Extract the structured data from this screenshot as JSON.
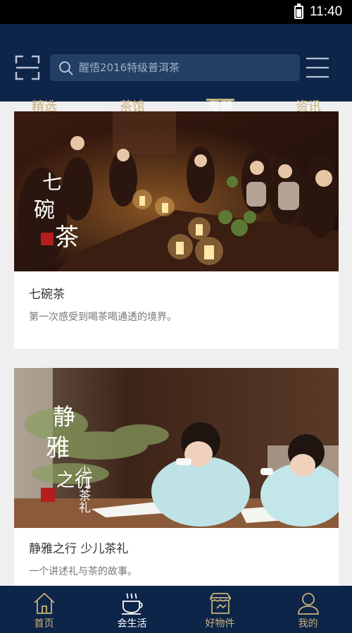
{
  "status_bar": {
    "time": "11:40"
  },
  "header": {
    "search_placeholder": "醒悟2016特级普洱茶"
  },
  "tabs": [
    {
      "label": "精选"
    },
    {
      "label": "茶馆"
    },
    {
      "label": "专题",
      "active": true
    },
    {
      "label": "资讯"
    }
  ],
  "cards": [
    {
      "title": "七碗茶",
      "description": "第一次感受到喝茶喝通透的境界。",
      "image_text": {
        "line1": "七",
        "line2": "碗",
        "line3": "茶"
      }
    },
    {
      "title": "静雅之行 少儿茶礼",
      "description": "一个讲述礼与茶的故事。",
      "image_text": {
        "main1": "静",
        "main2": "雅",
        "main3": "之行",
        "sub": "少儿茶礼"
      }
    }
  ],
  "bottom_nav": [
    {
      "label": "首页",
      "icon": "home-icon"
    },
    {
      "label": "会生活",
      "icon": "tea-cup-icon",
      "active": true
    },
    {
      "label": "好物件",
      "icon": "shop-icon"
    },
    {
      "label": "我的",
      "icon": "user-icon"
    }
  ],
  "colors": {
    "header_bg": "#0d2548",
    "accent_gold": "#c9b17c",
    "search_bg": "#233f63"
  }
}
